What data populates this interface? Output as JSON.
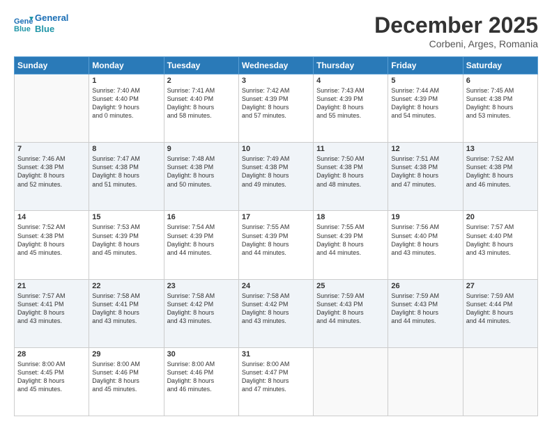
{
  "header": {
    "logo_line1": "General",
    "logo_line2": "Blue",
    "month": "December 2025",
    "location": "Corbeni, Arges, Romania"
  },
  "weekdays": [
    "Sunday",
    "Monday",
    "Tuesday",
    "Wednesday",
    "Thursday",
    "Friday",
    "Saturday"
  ],
  "weeks": [
    [
      {
        "day": "",
        "info": ""
      },
      {
        "day": "1",
        "info": "Sunrise: 7:40 AM\nSunset: 4:40 PM\nDaylight: 9 hours\nand 0 minutes."
      },
      {
        "day": "2",
        "info": "Sunrise: 7:41 AM\nSunset: 4:40 PM\nDaylight: 8 hours\nand 58 minutes."
      },
      {
        "day": "3",
        "info": "Sunrise: 7:42 AM\nSunset: 4:39 PM\nDaylight: 8 hours\nand 57 minutes."
      },
      {
        "day": "4",
        "info": "Sunrise: 7:43 AM\nSunset: 4:39 PM\nDaylight: 8 hours\nand 55 minutes."
      },
      {
        "day": "5",
        "info": "Sunrise: 7:44 AM\nSunset: 4:39 PM\nDaylight: 8 hours\nand 54 minutes."
      },
      {
        "day": "6",
        "info": "Sunrise: 7:45 AM\nSunset: 4:38 PM\nDaylight: 8 hours\nand 53 minutes."
      }
    ],
    [
      {
        "day": "7",
        "info": "Sunrise: 7:46 AM\nSunset: 4:38 PM\nDaylight: 8 hours\nand 52 minutes."
      },
      {
        "day": "8",
        "info": "Sunrise: 7:47 AM\nSunset: 4:38 PM\nDaylight: 8 hours\nand 51 minutes."
      },
      {
        "day": "9",
        "info": "Sunrise: 7:48 AM\nSunset: 4:38 PM\nDaylight: 8 hours\nand 50 minutes."
      },
      {
        "day": "10",
        "info": "Sunrise: 7:49 AM\nSunset: 4:38 PM\nDaylight: 8 hours\nand 49 minutes."
      },
      {
        "day": "11",
        "info": "Sunrise: 7:50 AM\nSunset: 4:38 PM\nDaylight: 8 hours\nand 48 minutes."
      },
      {
        "day": "12",
        "info": "Sunrise: 7:51 AM\nSunset: 4:38 PM\nDaylight: 8 hours\nand 47 minutes."
      },
      {
        "day": "13",
        "info": "Sunrise: 7:52 AM\nSunset: 4:38 PM\nDaylight: 8 hours\nand 46 minutes."
      }
    ],
    [
      {
        "day": "14",
        "info": "Sunrise: 7:52 AM\nSunset: 4:38 PM\nDaylight: 8 hours\nand 45 minutes."
      },
      {
        "day": "15",
        "info": "Sunrise: 7:53 AM\nSunset: 4:39 PM\nDaylight: 8 hours\nand 45 minutes."
      },
      {
        "day": "16",
        "info": "Sunrise: 7:54 AM\nSunset: 4:39 PM\nDaylight: 8 hours\nand 44 minutes."
      },
      {
        "day": "17",
        "info": "Sunrise: 7:55 AM\nSunset: 4:39 PM\nDaylight: 8 hours\nand 44 minutes."
      },
      {
        "day": "18",
        "info": "Sunrise: 7:55 AM\nSunset: 4:39 PM\nDaylight: 8 hours\nand 44 minutes."
      },
      {
        "day": "19",
        "info": "Sunrise: 7:56 AM\nSunset: 4:40 PM\nDaylight: 8 hours\nand 43 minutes."
      },
      {
        "day": "20",
        "info": "Sunrise: 7:57 AM\nSunset: 4:40 PM\nDaylight: 8 hours\nand 43 minutes."
      }
    ],
    [
      {
        "day": "21",
        "info": "Sunrise: 7:57 AM\nSunset: 4:41 PM\nDaylight: 8 hours\nand 43 minutes."
      },
      {
        "day": "22",
        "info": "Sunrise: 7:58 AM\nSunset: 4:41 PM\nDaylight: 8 hours\nand 43 minutes."
      },
      {
        "day": "23",
        "info": "Sunrise: 7:58 AM\nSunset: 4:42 PM\nDaylight: 8 hours\nand 43 minutes."
      },
      {
        "day": "24",
        "info": "Sunrise: 7:58 AM\nSunset: 4:42 PM\nDaylight: 8 hours\nand 43 minutes."
      },
      {
        "day": "25",
        "info": "Sunrise: 7:59 AM\nSunset: 4:43 PM\nDaylight: 8 hours\nand 44 minutes."
      },
      {
        "day": "26",
        "info": "Sunrise: 7:59 AM\nSunset: 4:43 PM\nDaylight: 8 hours\nand 44 minutes."
      },
      {
        "day": "27",
        "info": "Sunrise: 7:59 AM\nSunset: 4:44 PM\nDaylight: 8 hours\nand 44 minutes."
      }
    ],
    [
      {
        "day": "28",
        "info": "Sunrise: 8:00 AM\nSunset: 4:45 PM\nDaylight: 8 hours\nand 45 minutes."
      },
      {
        "day": "29",
        "info": "Sunrise: 8:00 AM\nSunset: 4:46 PM\nDaylight: 8 hours\nand 45 minutes."
      },
      {
        "day": "30",
        "info": "Sunrise: 8:00 AM\nSunset: 4:46 PM\nDaylight: 8 hours\nand 46 minutes."
      },
      {
        "day": "31",
        "info": "Sunrise: 8:00 AM\nSunset: 4:47 PM\nDaylight: 8 hours\nand 47 minutes."
      },
      {
        "day": "",
        "info": ""
      },
      {
        "day": "",
        "info": ""
      },
      {
        "day": "",
        "info": ""
      }
    ]
  ]
}
